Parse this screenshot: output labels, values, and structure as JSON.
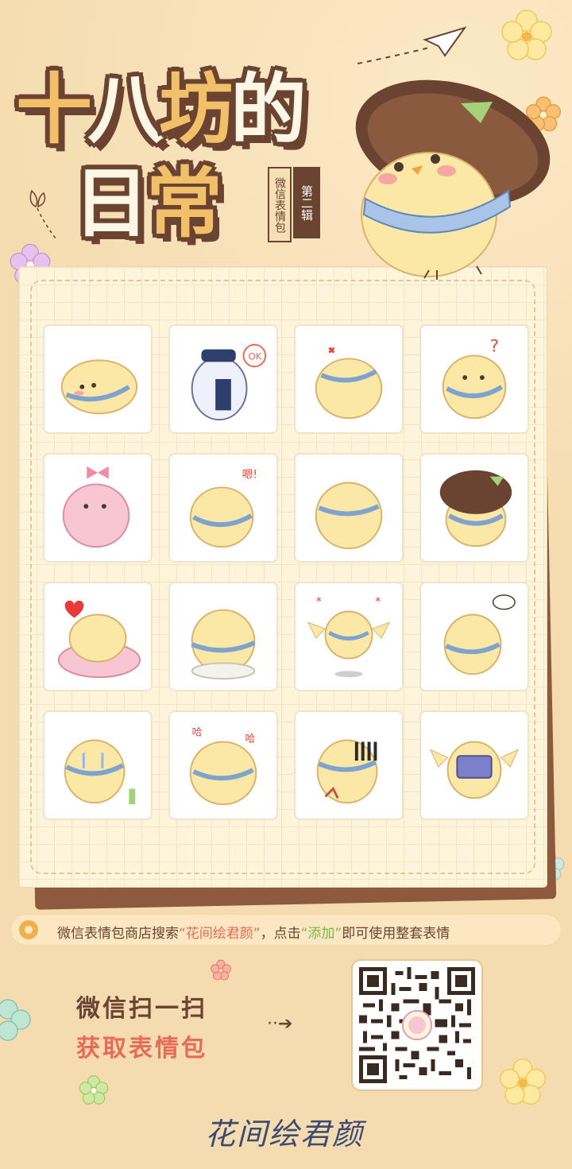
{
  "header": {
    "title_line1": [
      "十",
      "八",
      "坊",
      "的"
    ],
    "title_line2": [
      "日",
      "常"
    ],
    "subtitle_left": "微信表情包",
    "subtitle_right": "第二辑"
  },
  "hint": {
    "prefix": "微信表情包商店搜索",
    "keyword": "“花间绘君颜”",
    "middle": "，点击",
    "action": "“添加”",
    "suffix": "即可使用整套表情"
  },
  "scan": {
    "line1": "微信扫一扫",
    "line2": "获取表情包",
    "arrow": "··➔"
  },
  "sticker_texts": {
    "ok": "OK",
    "en": "嗯!",
    "ha1": "哈",
    "ha2": "哈"
  },
  "brand": {
    "logo_text": "花间绘君颜"
  },
  "colors": {
    "background": "#f5dcb0",
    "brown": "#6b4331",
    "accent_red": "#e86a58",
    "accent_green": "#7bb54b",
    "chick_yellow": "#fbe7a6",
    "scarf_blue": "#7fa3cf"
  },
  "stickers": [
    "chick-lying",
    "penguin-ok",
    "chick-angry",
    "chick-question",
    "pink-chick-pray",
    "chick-en",
    "chick-back",
    "chick-hat",
    "chick-pillow-heart",
    "chick-shell",
    "chick-flapping",
    "chick-thinking",
    "chick-crying",
    "chick-haha",
    "chick-shocked",
    "chick-gift"
  ]
}
